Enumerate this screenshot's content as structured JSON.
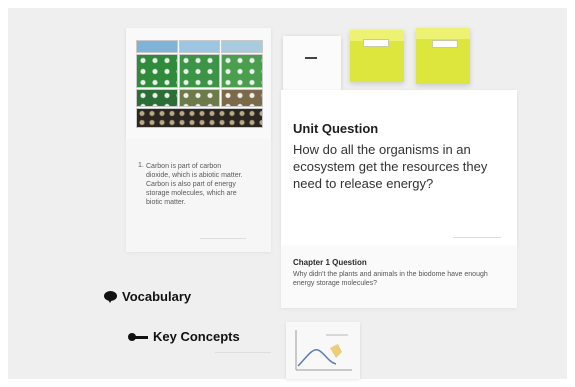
{
  "carbon_card": {
    "number": "1.",
    "text": "Carbon is part of carbon dioxide, which is abiotic matter. Carbon is also part of energy storage molecules, which are biotic matter."
  },
  "labels": {
    "vocabulary": "Vocabulary",
    "key_concepts": "Key Concepts"
  },
  "unit_question": {
    "title": "Unit Question",
    "text": "How do all the organisms in an ecosystem get the resources they need to release energy?"
  },
  "chapter_question": {
    "title": "Chapter 1 Question",
    "text": "Why didn't the plants and animals in the biodome have enough energy storage molecules?"
  },
  "colors": {
    "cube_yellow": "#dde63c",
    "cube_top": "#eef272",
    "photo_green": "#2f8a3c",
    "photo_sky": "#7fb4d8",
    "label_black": "#111111"
  },
  "icons": {
    "vocabulary_pointer": "speech-bubble-icon",
    "key_concepts_pointer": "key-icon"
  }
}
